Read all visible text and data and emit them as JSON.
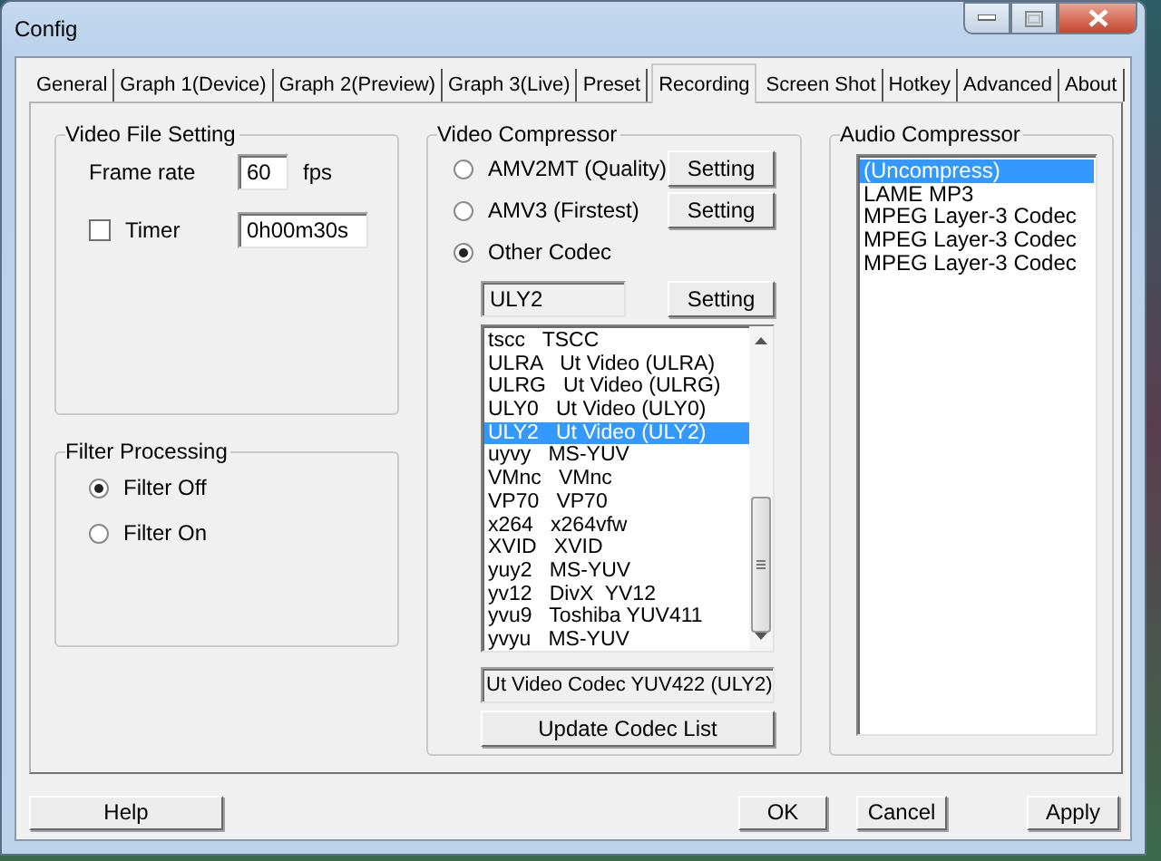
{
  "window": {
    "title": "Config"
  },
  "tabs": [
    {
      "label": "General",
      "selected": false
    },
    {
      "label": "Graph 1(Device)",
      "selected": false
    },
    {
      "label": "Graph 2(Preview)",
      "selected": false
    },
    {
      "label": "Graph 3(Live)",
      "selected": false
    },
    {
      "label": "Preset",
      "selected": false
    },
    {
      "label": "Recording",
      "selected": true
    },
    {
      "label": "Screen Shot",
      "selected": false
    },
    {
      "label": "Hotkey",
      "selected": false
    },
    {
      "label": "Advanced",
      "selected": false
    },
    {
      "label": "About",
      "selected": false
    }
  ],
  "video_file_setting": {
    "title": "Video File Setting",
    "frame_rate": {
      "label": "Frame rate",
      "value": "60",
      "unit": "fps"
    },
    "timer": {
      "label": "Timer",
      "checked": false,
      "value": "0h00m30s"
    }
  },
  "filter_processing": {
    "title": "Filter Processing",
    "options": [
      {
        "label": "Filter Off",
        "selected": true
      },
      {
        "label": "Filter On",
        "selected": false
      }
    ]
  },
  "video_compressor": {
    "title": "Video Compressor",
    "options": [
      {
        "label": "AMV2MT (Quality)",
        "selected": false,
        "button": "Setting"
      },
      {
        "label": "AMV3 (Firstest)",
        "selected": false,
        "button": "Setting"
      },
      {
        "label": "Other Codec",
        "selected": true
      }
    ],
    "codec_field": "ULY2",
    "codec_button": "Setting",
    "codec_list": [
      {
        "label": "tscc   TSCC",
        "selected": false
      },
      {
        "label": "ULRA   Ut Video (ULRA)",
        "selected": false
      },
      {
        "label": "ULRG   Ut Video (ULRG)",
        "selected": false
      },
      {
        "label": "ULY0   Ut Video (ULY0)",
        "selected": false
      },
      {
        "label": "ULY2   Ut Video (ULY2)",
        "selected": true
      },
      {
        "label": "uyvy   MS-YUV",
        "selected": false
      },
      {
        "label": "VMnc   VMnc",
        "selected": false
      },
      {
        "label": "VP70   VP70",
        "selected": false
      },
      {
        "label": "x264   x264vfw",
        "selected": false
      },
      {
        "label": "XVID   XVID",
        "selected": false
      },
      {
        "label": "yuy2   MS-YUV",
        "selected": false
      },
      {
        "label": "yv12   DivX  YV12",
        "selected": false
      },
      {
        "label": "yvu9   Toshiba YUV411",
        "selected": false
      },
      {
        "label": "yvyu   MS-YUV",
        "selected": false
      }
    ],
    "description": "Ut Video Codec YUV422 (ULY2)",
    "update_button": "Update Codec List"
  },
  "audio_compressor": {
    "title": "Audio Compressor",
    "items": [
      {
        "label": "(Uncompress)",
        "selected": true
      },
      {
        "label": "LAME MP3",
        "selected": false
      },
      {
        "label": "MPEG Layer-3 Codec",
        "selected": false
      },
      {
        "label": "MPEG Layer-3 Codec",
        "selected": false
      },
      {
        "label": "MPEG Layer-3 Codec",
        "selected": false
      }
    ]
  },
  "buttons": [
    {
      "label": "Help"
    },
    {
      "label": "OK"
    },
    {
      "label": "Cancel"
    },
    {
      "label": "Apply"
    }
  ]
}
